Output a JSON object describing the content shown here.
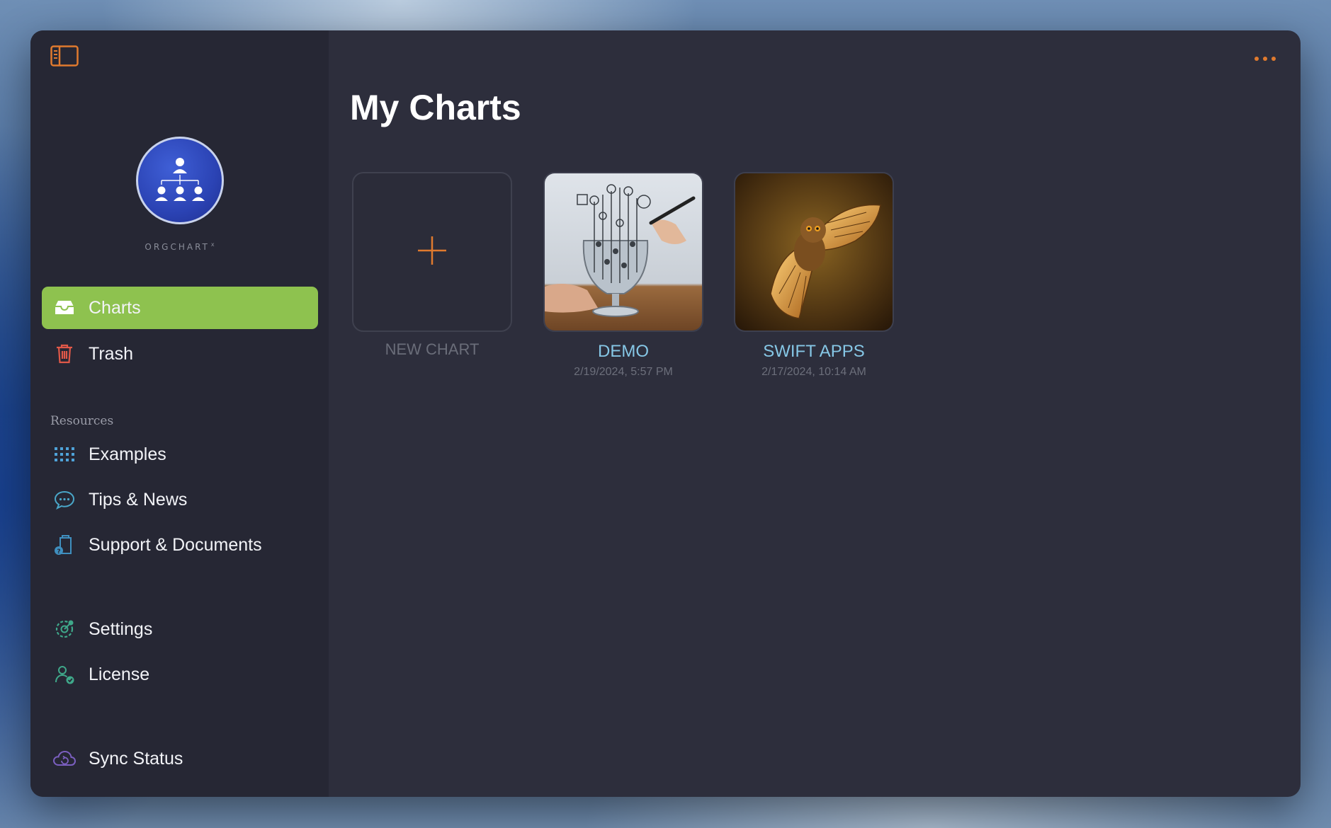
{
  "app": {
    "logo_text": "ORGCHART",
    "logo_sup": "x"
  },
  "sidebar": {
    "primary": [
      {
        "label": "Charts",
        "icon": "tray-icon",
        "active": true
      },
      {
        "label": "Trash",
        "icon": "trash-icon"
      }
    ],
    "resources_heading": "Resources",
    "resources": [
      {
        "label": "Examples",
        "icon": "grid-icon"
      },
      {
        "label": "Tips & News",
        "icon": "chat-bubble-icon"
      },
      {
        "label": "Support & Documents",
        "icon": "document-help-icon"
      }
    ],
    "account": [
      {
        "label": "Settings",
        "icon": "gear-icon"
      },
      {
        "label": "License",
        "icon": "person-check-icon"
      }
    ],
    "sync": {
      "label": "Sync Status",
      "icon": "cloud-sync-icon"
    }
  },
  "main": {
    "title": "My Charts",
    "cards": [
      {
        "title": "NEW CHART",
        "date": ""
      },
      {
        "title": "DEMO",
        "date": "2/19/2024, 5:57 PM"
      },
      {
        "title": "SWIFT APPS",
        "date": "2/17/2024, 10:14 AM"
      }
    ]
  },
  "colors": {
    "accent": "#e07a2e",
    "active_bg": "#8ec24f",
    "card_title": "#86c7e6",
    "sidebar_bg": "#262734",
    "main_bg": "#2d2e3c"
  }
}
